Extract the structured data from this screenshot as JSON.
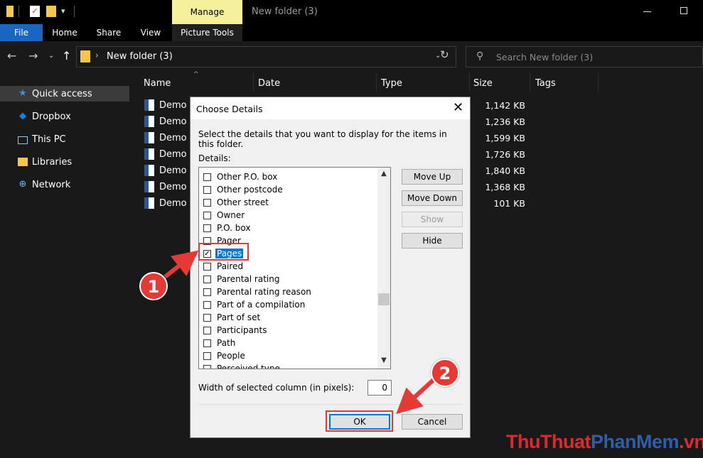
{
  "titlebar": {
    "manage_tab": "Manage",
    "window_title": "New folder (3)"
  },
  "ribbon": {
    "tabs": [
      "File",
      "Home",
      "Share",
      "View",
      "Picture Tools"
    ]
  },
  "address": {
    "path": "New folder (3)",
    "search_placeholder": "Search New folder (3)"
  },
  "sidebar": {
    "items": [
      {
        "label": "Quick access",
        "icon": "star-icon"
      },
      {
        "label": "Dropbox",
        "icon": "dropbox-icon"
      },
      {
        "label": "This PC",
        "icon": "computer-icon"
      },
      {
        "label": "Libraries",
        "icon": "libraries-icon"
      },
      {
        "label": "Network",
        "icon": "network-icon"
      }
    ]
  },
  "columns": [
    "Name",
    "Date",
    "Type",
    "Size",
    "Tags"
  ],
  "files": [
    {
      "name": "Demo (",
      "size": "1,142 KB"
    },
    {
      "name": "Demo (",
      "size": "1,236 KB"
    },
    {
      "name": "Demo (",
      "size": "1,599 KB"
    },
    {
      "name": "Demo (",
      "size": "1,726 KB"
    },
    {
      "name": "Demo (",
      "size": "1,840 KB"
    },
    {
      "name": "Demo (",
      "size": "1,368 KB"
    },
    {
      "name": "Demo (",
      "size": "101 KB"
    }
  ],
  "dialog": {
    "title": "Choose Details",
    "instructions": "Select the details that you want to display for the items in this folder.",
    "details_label": "Details:",
    "items": [
      {
        "label": "Other P.O. box",
        "checked": false
      },
      {
        "label": "Other postcode",
        "checked": false
      },
      {
        "label": "Other street",
        "checked": false
      },
      {
        "label": "Owner",
        "checked": false
      },
      {
        "label": "P.O. box",
        "checked": false
      },
      {
        "label": "Pager",
        "checked": false
      },
      {
        "label": "Pages",
        "checked": true
      },
      {
        "label": "Paired",
        "checked": false
      },
      {
        "label": "Parental rating",
        "checked": false
      },
      {
        "label": "Parental rating reason",
        "checked": false
      },
      {
        "label": "Part of a compilation",
        "checked": false
      },
      {
        "label": "Part of set",
        "checked": false
      },
      {
        "label": "Participants",
        "checked": false
      },
      {
        "label": "Path",
        "checked": false
      },
      {
        "label": "People",
        "checked": false
      },
      {
        "label": "Perceived type",
        "checked": false
      }
    ],
    "buttons": {
      "move_up": "Move Up",
      "move_down": "Move Down",
      "show": "Show",
      "hide": "Hide",
      "ok": "OK",
      "cancel": "Cancel"
    },
    "width_label": "Width of selected column (in pixels):",
    "width_value": "0"
  },
  "annotations": {
    "step1": "1",
    "step2": "2",
    "color": "#e53935"
  },
  "watermark": {
    "part_a": "ThuThuat",
    "part_b": "PhanMem",
    "part_c": ".vn"
  }
}
